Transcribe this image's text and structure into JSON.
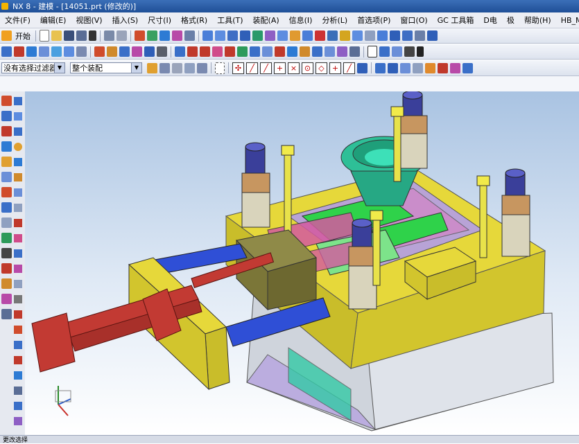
{
  "window": {
    "title": "NX 8 - 建模 - [14051.prt (修改的)]"
  },
  "menu": [
    "文件(F)",
    "编辑(E)",
    "视图(V)",
    "插入(S)",
    "尺寸(I)",
    "格式(R)",
    "工具(T)",
    "装配(A)",
    "信息(I)",
    "分析(L)",
    "首选项(P)",
    "窗口(O)",
    "GC 工具箱",
    "D电",
    "极",
    "帮助(H)",
    "HB_MOULD"
  ],
  "toolbar1": {
    "start_label": "开始"
  },
  "selection": {
    "filter": "没有选择过滤器",
    "scope": "整个装配"
  },
  "statusbar": {
    "text": "更改选择"
  },
  "colors": {
    "plate_yellow": "#e6d83a",
    "blue": "#2f4fd6",
    "red": "#c23a33",
    "green": "#2fd24a",
    "teal": "#34c9a6",
    "gray": "#cfd4dc"
  }
}
